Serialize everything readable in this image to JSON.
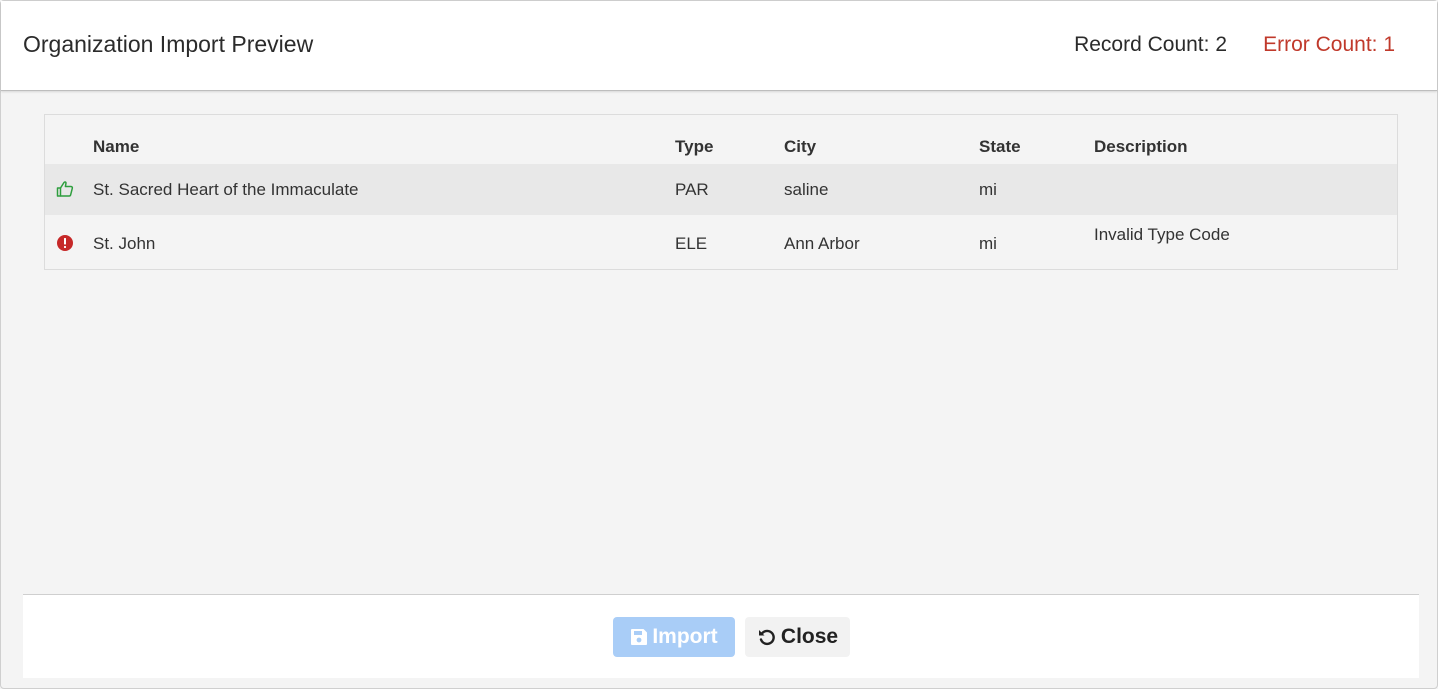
{
  "header": {
    "title": "Organization Import Preview",
    "record_count": "Record Count: 2",
    "error_count": "Error Count: 1",
    "error_color": "#c0392b"
  },
  "table": {
    "columns": [
      "Name",
      "Type",
      "City",
      "State",
      "Description"
    ],
    "rows": [
      {
        "status_icon": "thumbs-up-icon",
        "status_color": "#2e9e3e",
        "name": "St. Sacred Heart of the Immaculate",
        "type": "PAR",
        "city": "saline",
        "state": "mi",
        "description": ""
      },
      {
        "status_icon": "error-circle-icon",
        "status_color": "#c62828",
        "name": "St. John",
        "type": "ELE",
        "city": "Ann Arbor",
        "state": "mi",
        "description": "Invalid Type Code"
      }
    ]
  },
  "footer": {
    "import_label": "Import",
    "import_icon": "save-icon",
    "close_label": "Close",
    "close_icon": "undo-icon",
    "import_color": "#a9cdf7"
  }
}
